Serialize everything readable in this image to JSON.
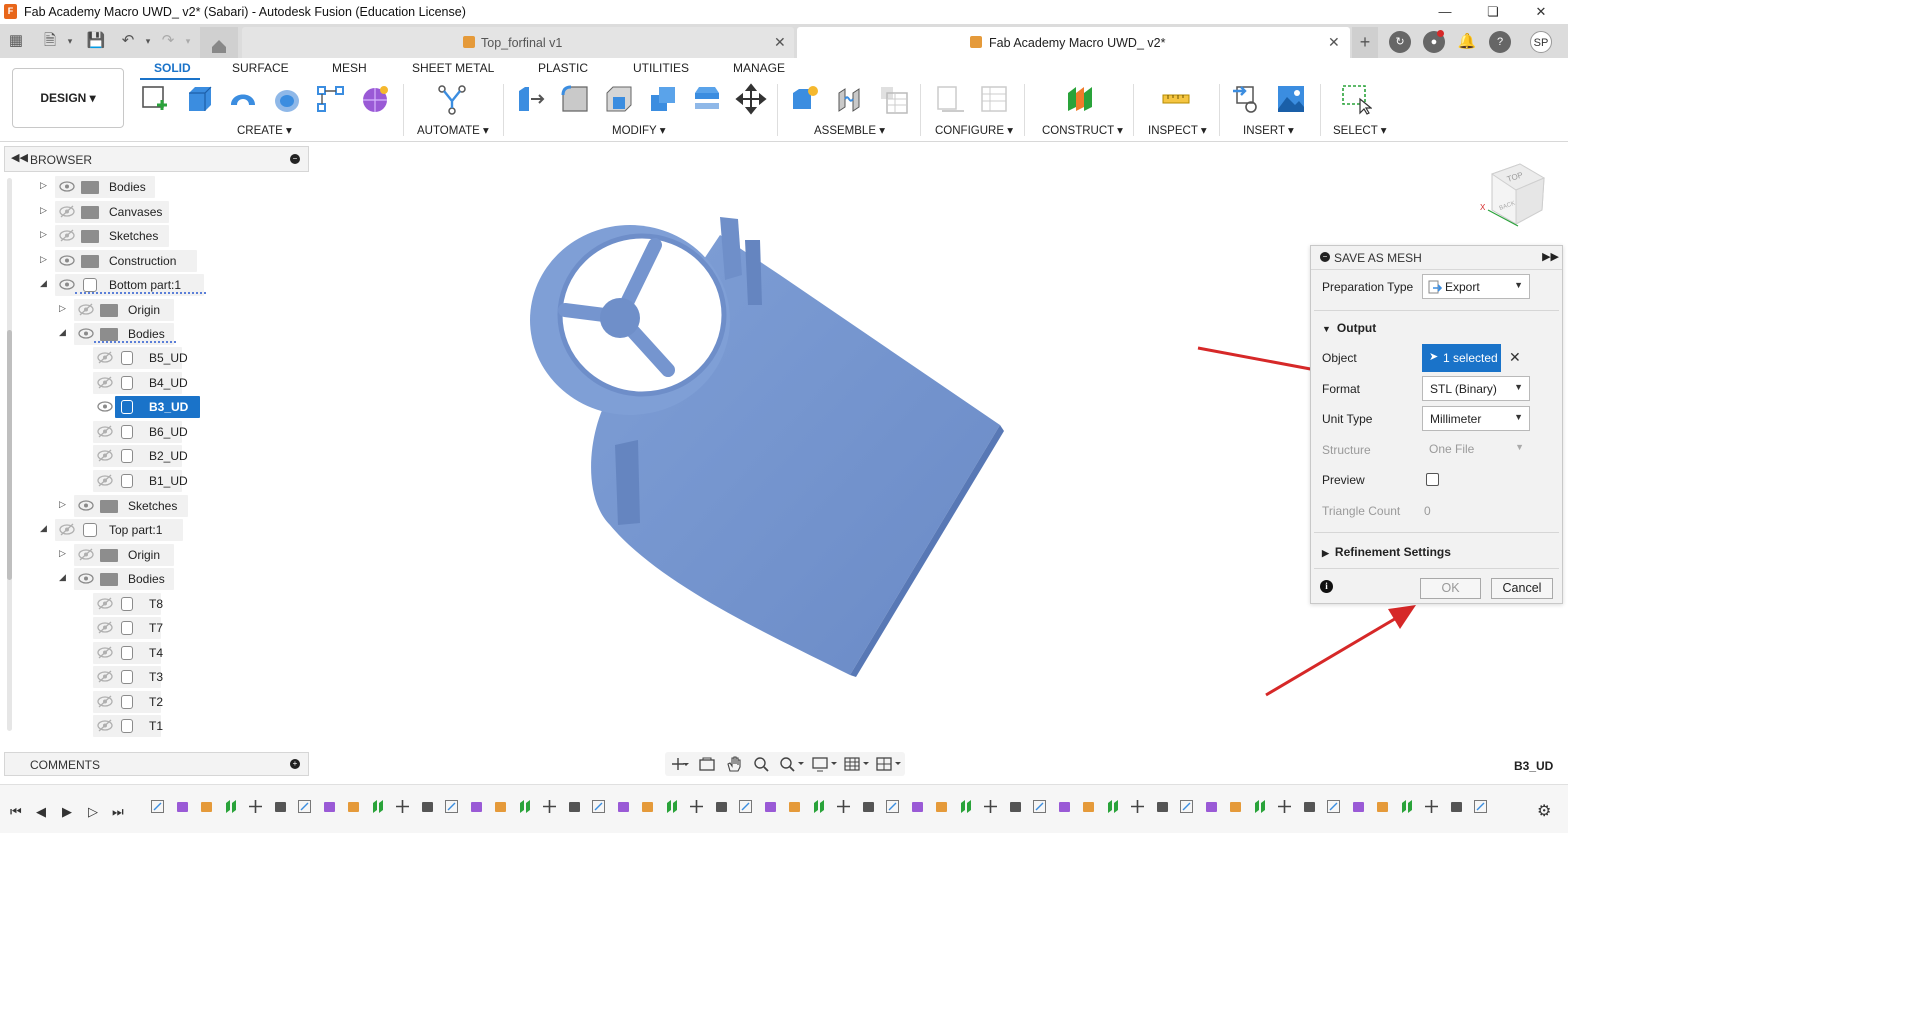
{
  "window": {
    "title": "Fab Academy Macro UWD_ v2* (Sabari) - Autodesk Fusion (Education License)",
    "app_icon_letter": "F"
  },
  "tabs": [
    {
      "label": "Top_forfinal v1",
      "active": false
    },
    {
      "label": "Fab Academy Macro UWD_ v2*",
      "active": true
    }
  ],
  "user": {
    "initials": "SP"
  },
  "toolbar": {
    "workspace_label": "DESIGN ▾",
    "workspace_tabs": [
      "SOLID",
      "SURFACE",
      "MESH",
      "SHEET METAL",
      "PLASTIC",
      "UTILITIES",
      "MANAGE"
    ],
    "groups": [
      {
        "label": "CREATE ▾"
      },
      {
        "label": "AUTOMATE ▾"
      },
      {
        "label": "MODIFY ▾"
      },
      {
        "label": "ASSEMBLE ▾"
      },
      {
        "label": "CONFIGURE ▾"
      },
      {
        "label": "CONSTRUCT ▾"
      },
      {
        "label": "INSPECT ▾"
      },
      {
        "label": "INSERT ▾"
      },
      {
        "label": "SELECT ▾"
      }
    ]
  },
  "browser": {
    "title": "BROWSER",
    "items": [
      {
        "label": "Bodies",
        "type": "folder",
        "visible": true
      },
      {
        "label": "Canvases",
        "type": "folder",
        "visible": false
      },
      {
        "label": "Sketches",
        "type": "folder",
        "visible": false
      },
      {
        "label": "Construction",
        "type": "folder",
        "visible": true
      },
      {
        "label": "Bottom part:1",
        "type": "component",
        "visible": true
      },
      {
        "label": "Origin",
        "type": "folder",
        "visible": false
      },
      {
        "label": "Bodies",
        "type": "folder",
        "visible": true
      },
      {
        "label": "B5_UD",
        "type": "body",
        "visible": false
      },
      {
        "label": "B4_UD",
        "type": "body",
        "visible": false
      },
      {
        "label": "B3_UD",
        "type": "body",
        "visible": true,
        "selected": true
      },
      {
        "label": "B6_UD",
        "type": "body",
        "visible": false
      },
      {
        "label": "B2_UD",
        "type": "body",
        "visible": false
      },
      {
        "label": "B1_UD",
        "type": "body",
        "visible": false
      },
      {
        "label": "Sketches",
        "type": "folder",
        "visible": true
      },
      {
        "label": "Top part:1",
        "type": "component",
        "visible": false
      },
      {
        "label": "Origin",
        "type": "folder",
        "visible": false
      },
      {
        "label": "Bodies",
        "type": "folder",
        "visible": true
      },
      {
        "label": "T8",
        "type": "body",
        "visible": false
      },
      {
        "label": "T7",
        "type": "body",
        "visible": false
      },
      {
        "label": "T4",
        "type": "body",
        "visible": false
      },
      {
        "label": "T3",
        "type": "body",
        "visible": false
      },
      {
        "label": "T2",
        "type": "body",
        "visible": false
      },
      {
        "label": "T1",
        "type": "body",
        "visible": false
      }
    ]
  },
  "comments": {
    "title": "COMMENTS"
  },
  "viewcube": {
    "face_top": "TOP",
    "face_back": "BACK",
    "axis_x": "X"
  },
  "dialog": {
    "title": "SAVE AS MESH",
    "preparation_type_label": "Preparation Type",
    "preparation_type_value": "Export",
    "output_section": "Output",
    "object_label": "Object",
    "object_value": "1 selected",
    "format_label": "Format",
    "format_value": "STL (Binary)",
    "unit_type_label": "Unit Type",
    "unit_type_value": "Millimeter",
    "structure_label": "Structure",
    "structure_value": "One File",
    "preview_label": "Preview",
    "preview_checked": false,
    "triangle_count_label": "Triangle Count",
    "triangle_count_value": "0",
    "refinement_section": "Refinement Settings",
    "ok_label": "OK",
    "cancel_label": "Cancel"
  },
  "status": {
    "selected_name": "B3_UD"
  },
  "colors": {
    "accent": "#1a73c9",
    "model": "#6f8fc9",
    "annotation_arrow": "#d62828"
  }
}
